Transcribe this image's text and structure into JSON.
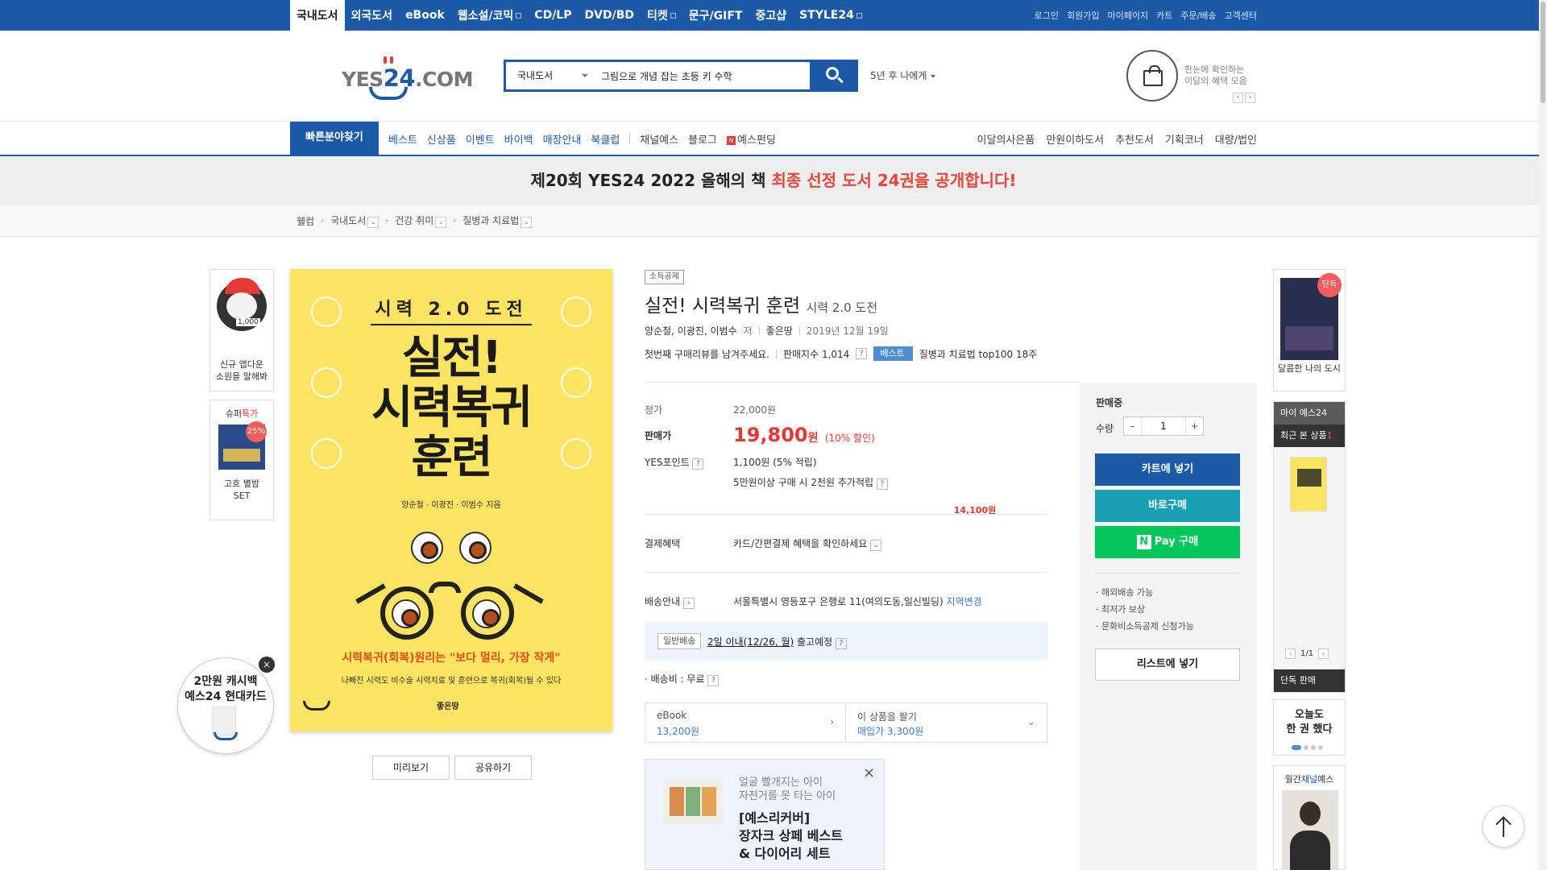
{
  "top_nav": {
    "items": [
      "국내도서",
      "외국도서",
      "eBook",
      "웹소설/코믹",
      "CD/LP",
      "DVD/BD",
      "티켓",
      "문구/GIFT",
      "중고샵",
      "STYLE24"
    ],
    "active": "국내도서"
  },
  "top_util": {
    "items": [
      "로그인",
      "회원가입",
      "마이페이지",
      "카트",
      "주문/배송",
      "고객센터"
    ]
  },
  "logo": {
    "part1": "YES",
    "part2": "24",
    "part3": ".COM"
  },
  "search": {
    "category": "국내도서",
    "value": "그림으로 개념 잡는 초등 키 수학",
    "keyword": "5년 후 나에게"
  },
  "benefit": {
    "line1": "한눈에 확인하는",
    "line2": "이달의 혜택 모음"
  },
  "secondary_nav": {
    "quick": "빠른분야찾기",
    "left_blue": [
      "베스트",
      "신상품",
      "이벤트",
      "바이백",
      "매장안내",
      "북클럽"
    ],
    "left_gray": [
      "채널예스",
      "블로그",
      "예스펀딩"
    ],
    "right": [
      "이달의사은품",
      "만원이하도서",
      "추천도서",
      "기획코너",
      "대량/법인"
    ]
  },
  "banner": {
    "prefix": "제20회 YES24 2022 올해의 책 ",
    "highlight": "최종 선정 도서 24권을 공개합니다!"
  },
  "breadcrumb": [
    "웰컴",
    "국내도서",
    "건강 취미",
    "질병과 치료법"
  ],
  "left_promos": {
    "promo1": {
      "coin": "1,000",
      "line1": "신규 앱다운",
      "line2": "소원을 말해봐"
    },
    "promo2": {
      "head": "슈퍼",
      "head_red": "특가",
      "discount": "25%",
      "name1": "고흐 별밤",
      "name2": "SET",
      "price": "14,100원"
    },
    "cashback": {
      "line1": "2만원 캐시백",
      "line2": "예스24 현대카드"
    }
  },
  "cover": {
    "subtitle": "시력 2.0 도전",
    "title_line1": "실전!",
    "title_line2": "시력복귀",
    "title_line3": "훈련",
    "authors": "양순철 · 이광진 · 이범수 지음",
    "slogan": "시력복귀(회복)원리는 \"보다 멀리, 가장 작게\"",
    "desc": "나빠진 시력도 비수술 시력치료 및 훈련으로 복귀(회복)될 수 있다",
    "publisher": "좋은땅"
  },
  "cover_buttons": {
    "preview": "미리보기",
    "share": "공유하기"
  },
  "product": {
    "badge": "소득공제",
    "title": "실전! 시력복귀 훈련",
    "subtitle": "시력 2.0 도전",
    "authors": "양순철, 이광진, 이범수",
    "authors_suffix": "저",
    "publisher": "좋은땅",
    "date": "2019년 12월 19일",
    "review_prompt": "첫번째 구매리뷰를 남겨주세요.",
    "sales_index": "판매지수 1,014",
    "best_badge": "베스트",
    "best_rank": "질병과 치료법 top100 18주"
  },
  "pricing": {
    "list_label": "정가",
    "list_price": "22,000원",
    "sale_label": "판매가",
    "sale_price": "19,800",
    "sale_unit": "원",
    "discount": "(10% 할인)",
    "points_label": "YES포인트",
    "points": "1,100원 (5% 적립)",
    "points_extra": "5만원이상 구매 시 2천원 추가적립",
    "benefit_label": "결제혜택",
    "benefit_value": "카드/간편결제 혜택을 확인하세요",
    "ship_label": "배송안내",
    "ship_address": "서울특별시 영등포구 은행로 11(여의도동,일신빌딩)",
    "ship_change": "지역변경",
    "ship_tag": "일반배송",
    "ship_date": "2일 이내(12/26, 월)",
    "ship_date_suffix": "출고예정",
    "ship_fee": "· 배송비 : 무료"
  },
  "options": {
    "ebook_label": "eBook",
    "ebook_price": "13,200원",
    "sell_label": "이 상품을 팔기",
    "sell_price": "매입가 3,300원"
  },
  "ad": {
    "line1": "얼굴 빨개지는 아이",
    "line2": "자전거를 못 타는 아이",
    "line3": "[예스리커버]",
    "line4": "장자크 상페 베스트",
    "line5": "& 다이어리 세트"
  },
  "buy_panel": {
    "status": "판매중",
    "qty_label": "수량",
    "qty": "1",
    "cart": "카트에 넣기",
    "buy_now": "바로구매",
    "npay": "Pay 구매",
    "notes": [
      "· 해외배송 가능",
      "· 최저가 보상",
      "· 문화비소득공제 신청가능"
    ],
    "list": "리스트에 넣기"
  },
  "right_sidebar": {
    "exclusive_tag": "단독",
    "book_name": "달콤한 나의 도시",
    "my_label": "마이 예스24",
    "recent_label": "최근 본 상품",
    "recent_count": "1",
    "pager": "1/1",
    "exclusive_sale": "단독 판매",
    "today_line1": "오늘도",
    "today_line2": "한 권 했다",
    "channel_pre": "월간",
    "channel_blue": "채널",
    "channel_post": "예스"
  }
}
